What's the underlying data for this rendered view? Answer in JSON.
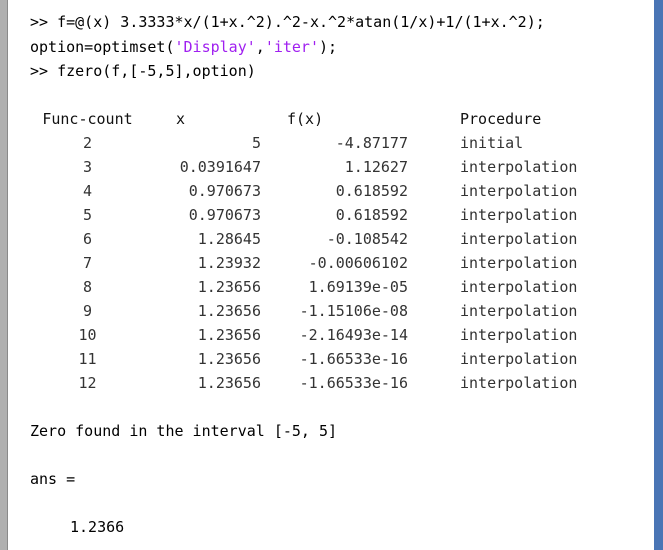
{
  "commands": {
    "line1_prompt": ">> ",
    "line1_code": "f=@(x) 3.3333*x/(1+x.^2).^2-x.^2*atan(1/x)+1/(1+x.^2);",
    "line2_pre": "option=optimset(",
    "line2_str1": "'Display'",
    "line2_sep": ",",
    "line2_str2": "'iter'",
    "line2_post": ");",
    "line3_prompt": ">> ",
    "line3_code": "fzero(f,[-5,5],option)"
  },
  "table": {
    "headers": {
      "count": "Func-count",
      "x": "x",
      "fx": "f(x)",
      "procedure": "Procedure"
    },
    "rows": [
      {
        "count": "2",
        "x": "5",
        "fx": "-4.87177",
        "procedure": "initial"
      },
      {
        "count": "3",
        "x": "0.0391647",
        "fx": "1.12627",
        "procedure": "interpolation"
      },
      {
        "count": "4",
        "x": "0.970673",
        "fx": "0.618592",
        "procedure": "interpolation"
      },
      {
        "count": "5",
        "x": "0.970673",
        "fx": "0.618592",
        "procedure": "interpolation"
      },
      {
        "count": "6",
        "x": "1.28645",
        "fx": "-0.108542",
        "procedure": "interpolation"
      },
      {
        "count": "7",
        "x": "1.23932",
        "fx": "-0.00606102",
        "procedure": "interpolation"
      },
      {
        "count": "8",
        "x": "1.23656",
        "fx": "1.69139e-05",
        "procedure": "interpolation"
      },
      {
        "count": "9",
        "x": "1.23656",
        "fx": "-1.15106e-08",
        "procedure": "interpolation"
      },
      {
        "count": "10",
        "x": "1.23656",
        "fx": "-2.16493e-14",
        "procedure": "interpolation"
      },
      {
        "count": "11",
        "x": "1.23656",
        "fx": "-1.66533e-16",
        "procedure": "interpolation"
      },
      {
        "count": "12",
        "x": "1.23656",
        "fx": "-1.66533e-16",
        "procedure": "interpolation"
      }
    ]
  },
  "result": {
    "message": "Zero found in the interval [-5, 5]",
    "ans_label": "ans =",
    "ans_value": "1.2366"
  },
  "colors": {
    "string_literal": "#a020f0",
    "scrollbar": "#4a75b5"
  }
}
